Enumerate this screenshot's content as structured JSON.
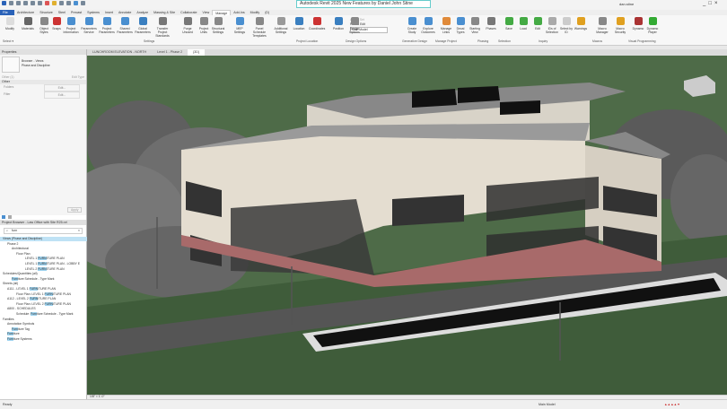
{
  "app": {
    "title": "Autodesk Revit 2025 New Features by Daniel John Stine",
    "user": "dan.stine",
    "window_controls": [
      "_",
      "□",
      "×"
    ]
  },
  "ribbon_tabs": [
    "File",
    "Architecture",
    "Structure",
    "Steel",
    "Precast",
    "Systems",
    "Insert",
    "Annotate",
    "Analyze",
    "Massing & Site",
    "Collaborate",
    "View",
    "Manage",
    "Add-Ins",
    "Modify",
    "(D)"
  ],
  "active_tab": "Manage",
  "ribbon_buttons": [
    {
      "label": "Modify",
      "color": "#ddd"
    },
    {
      "label": "Materials",
      "color": "#666"
    },
    {
      "label": "Object Styles",
      "color": "#888"
    },
    {
      "label": "Snaps",
      "color": "#c33"
    },
    {
      "label": "Project Information",
      "color": "#4a8fd0"
    },
    {
      "label": "Parameters Service",
      "color": "#4a8fd0"
    },
    {
      "label": "Project Parameters",
      "color": "#4a8fd0"
    },
    {
      "label": "Shared Parameters",
      "color": "#4a8fd0"
    },
    {
      "label": "Global Parameters",
      "color": "#3a7fc0"
    },
    {
      "label": "Transfer Project Standards",
      "color": "#777"
    },
    {
      "label": "Purge Unused",
      "color": "#777"
    },
    {
      "label": "Project Units",
      "color": "#888"
    },
    {
      "label": "Structural Settings",
      "color": "#888"
    },
    {
      "label": "MEP Settings",
      "color": "#4a8fd0"
    },
    {
      "label": "Panel Schedule Templates",
      "color": "#888"
    },
    {
      "label": "Additional Settings",
      "color": "#999"
    },
    {
      "label": "Location",
      "color": "#3a7fc0"
    },
    {
      "label": "Coordinates",
      "color": "#c33"
    },
    {
      "label": "Position",
      "color": "#3a7fc0"
    },
    {
      "label": "Design Options",
      "color": "#888"
    },
    {
      "label": "Create Study",
      "color": "#4a8fd0"
    },
    {
      "label": "Explore Outcomes",
      "color": "#4a8fd0"
    },
    {
      "label": "Manage Links",
      "color": "#e08a3a"
    },
    {
      "label": "Decal Types",
      "color": "#4a8fd0"
    },
    {
      "label": "Starting View",
      "color": "#888"
    },
    {
      "label": "Phases",
      "color": "#777"
    },
    {
      "label": "Save",
      "color": "#4a4"
    },
    {
      "label": "Load",
      "color": "#4a4"
    },
    {
      "label": "Edit",
      "color": "#4a4"
    },
    {
      "label": "IDs of Selection",
      "color": "#aaa"
    },
    {
      "label": "Select by ID",
      "color": "#ccc"
    },
    {
      "label": "Warnings",
      "color": "#e0a020"
    },
    {
      "label": "Macro Manager",
      "color": "#888"
    },
    {
      "label": "Macro Security",
      "color": "#e0a020"
    },
    {
      "label": "Dynamo",
      "color": "#a33"
    },
    {
      "label": "Dynamo Player",
      "color": "#3a3"
    }
  ],
  "design_options": {
    "add_to_set": "Add to Set",
    "pick_to_edit": "Pick to Edit",
    "current": "Main Model"
  },
  "panel_labels": [
    "Select ▾",
    "Settings",
    "Project Location",
    "Design Options",
    "Generative Design",
    "Manage Project",
    "Phasing",
    "Selection",
    "Inquiry",
    "Macros",
    "Visual Programming"
  ],
  "doc_tabs": [
    "LUNCHROOM ELEVATION - NORTH",
    "Level 1 - Phase 2",
    "{3D}"
  ],
  "properties": {
    "title": "Properties",
    "type_line1": "Browser - Views",
    "type_line2": "Phase and Discipline",
    "filter": "Other (1)",
    "edit_type": "Edit Type",
    "group": "Other",
    "rows": [
      {
        "name": "Folders",
        "value": "Edit..."
      },
      {
        "name": "Filter",
        "value": "Edit..."
      }
    ],
    "apply": "Apply"
  },
  "browser": {
    "title": "Project Browser - Law Office with Site R25.rvt",
    "search": "furn",
    "items": [
      {
        "pre": "",
        "hl": "",
        "post": "Views (Phase and Discipline)",
        "indent": 0,
        "sel": true
      },
      {
        "pre": "",
        "hl": "",
        "post": "Phase 2",
        "indent": 1
      },
      {
        "pre": "",
        "hl": "",
        "post": "Architectural",
        "indent": 2
      },
      {
        "pre": "",
        "hl": "",
        "post": "Floor Plan",
        "indent": 3
      },
      {
        "pre": "LEVEL 1 ",
        "hl": "FURN",
        "post": "ITURE PLAN",
        "indent": 5
      },
      {
        "pre": "LEVEL 1 ",
        "hl": "FURN",
        "post": "ITURE PLAN - LOBBY E",
        "indent": 5
      },
      {
        "pre": "LEVEL 2 ",
        "hl": "FURN",
        "post": "ITURE PLAN",
        "indent": 5
      },
      {
        "pre": "",
        "hl": "",
        "post": "Schedules/Quantities (all)",
        "indent": 0
      },
      {
        "pre": "",
        "hl": "Furn",
        "post": "iture Schedule - Type Mark",
        "indent": 2
      },
      {
        "pre": "",
        "hl": "",
        "post": "Sheets (all)",
        "indent": 0
      },
      {
        "pre": "A111 - LEVEL 1 ",
        "hl": "FURN",
        "post": "ITURE PLAN",
        "indent": 1
      },
      {
        "pre": "Floor Plan: LEVEL 1 ",
        "hl": "FURN",
        "post": "ITURE PLAN",
        "indent": 3
      },
      {
        "pre": "A112 - LEVEL 2 ",
        "hl": "FURN",
        "post": "ITURE PLAN",
        "indent": 1
      },
      {
        "pre": "Floor Plan: LEVEL 2 ",
        "hl": "FURN",
        "post": "ITURE PLAN",
        "indent": 3
      },
      {
        "pre": "",
        "hl": "",
        "post": "A800 - SCHEDULES",
        "indent": 1
      },
      {
        "pre": "Schedule: ",
        "hl": "Furn",
        "post": "iture Schedule - Type Mark",
        "indent": 3
      },
      {
        "pre": "",
        "hl": "",
        "post": "Families",
        "indent": 0
      },
      {
        "pre": "",
        "hl": "",
        "post": "Annotation Symbols",
        "indent": 1
      },
      {
        "pre": "",
        "hl": "Furn",
        "post": "iture Tag",
        "indent": 2
      },
      {
        "pre": "",
        "hl": "Furn",
        "post": "iture",
        "indent": 1
      },
      {
        "pre": "",
        "hl": "Furn",
        "post": "iture Systems",
        "indent": 1
      }
    ]
  },
  "view_control": {
    "scale": "1/8\" = 1'-0\""
  },
  "status": {
    "text": "Ready",
    "model": "Main Model"
  }
}
